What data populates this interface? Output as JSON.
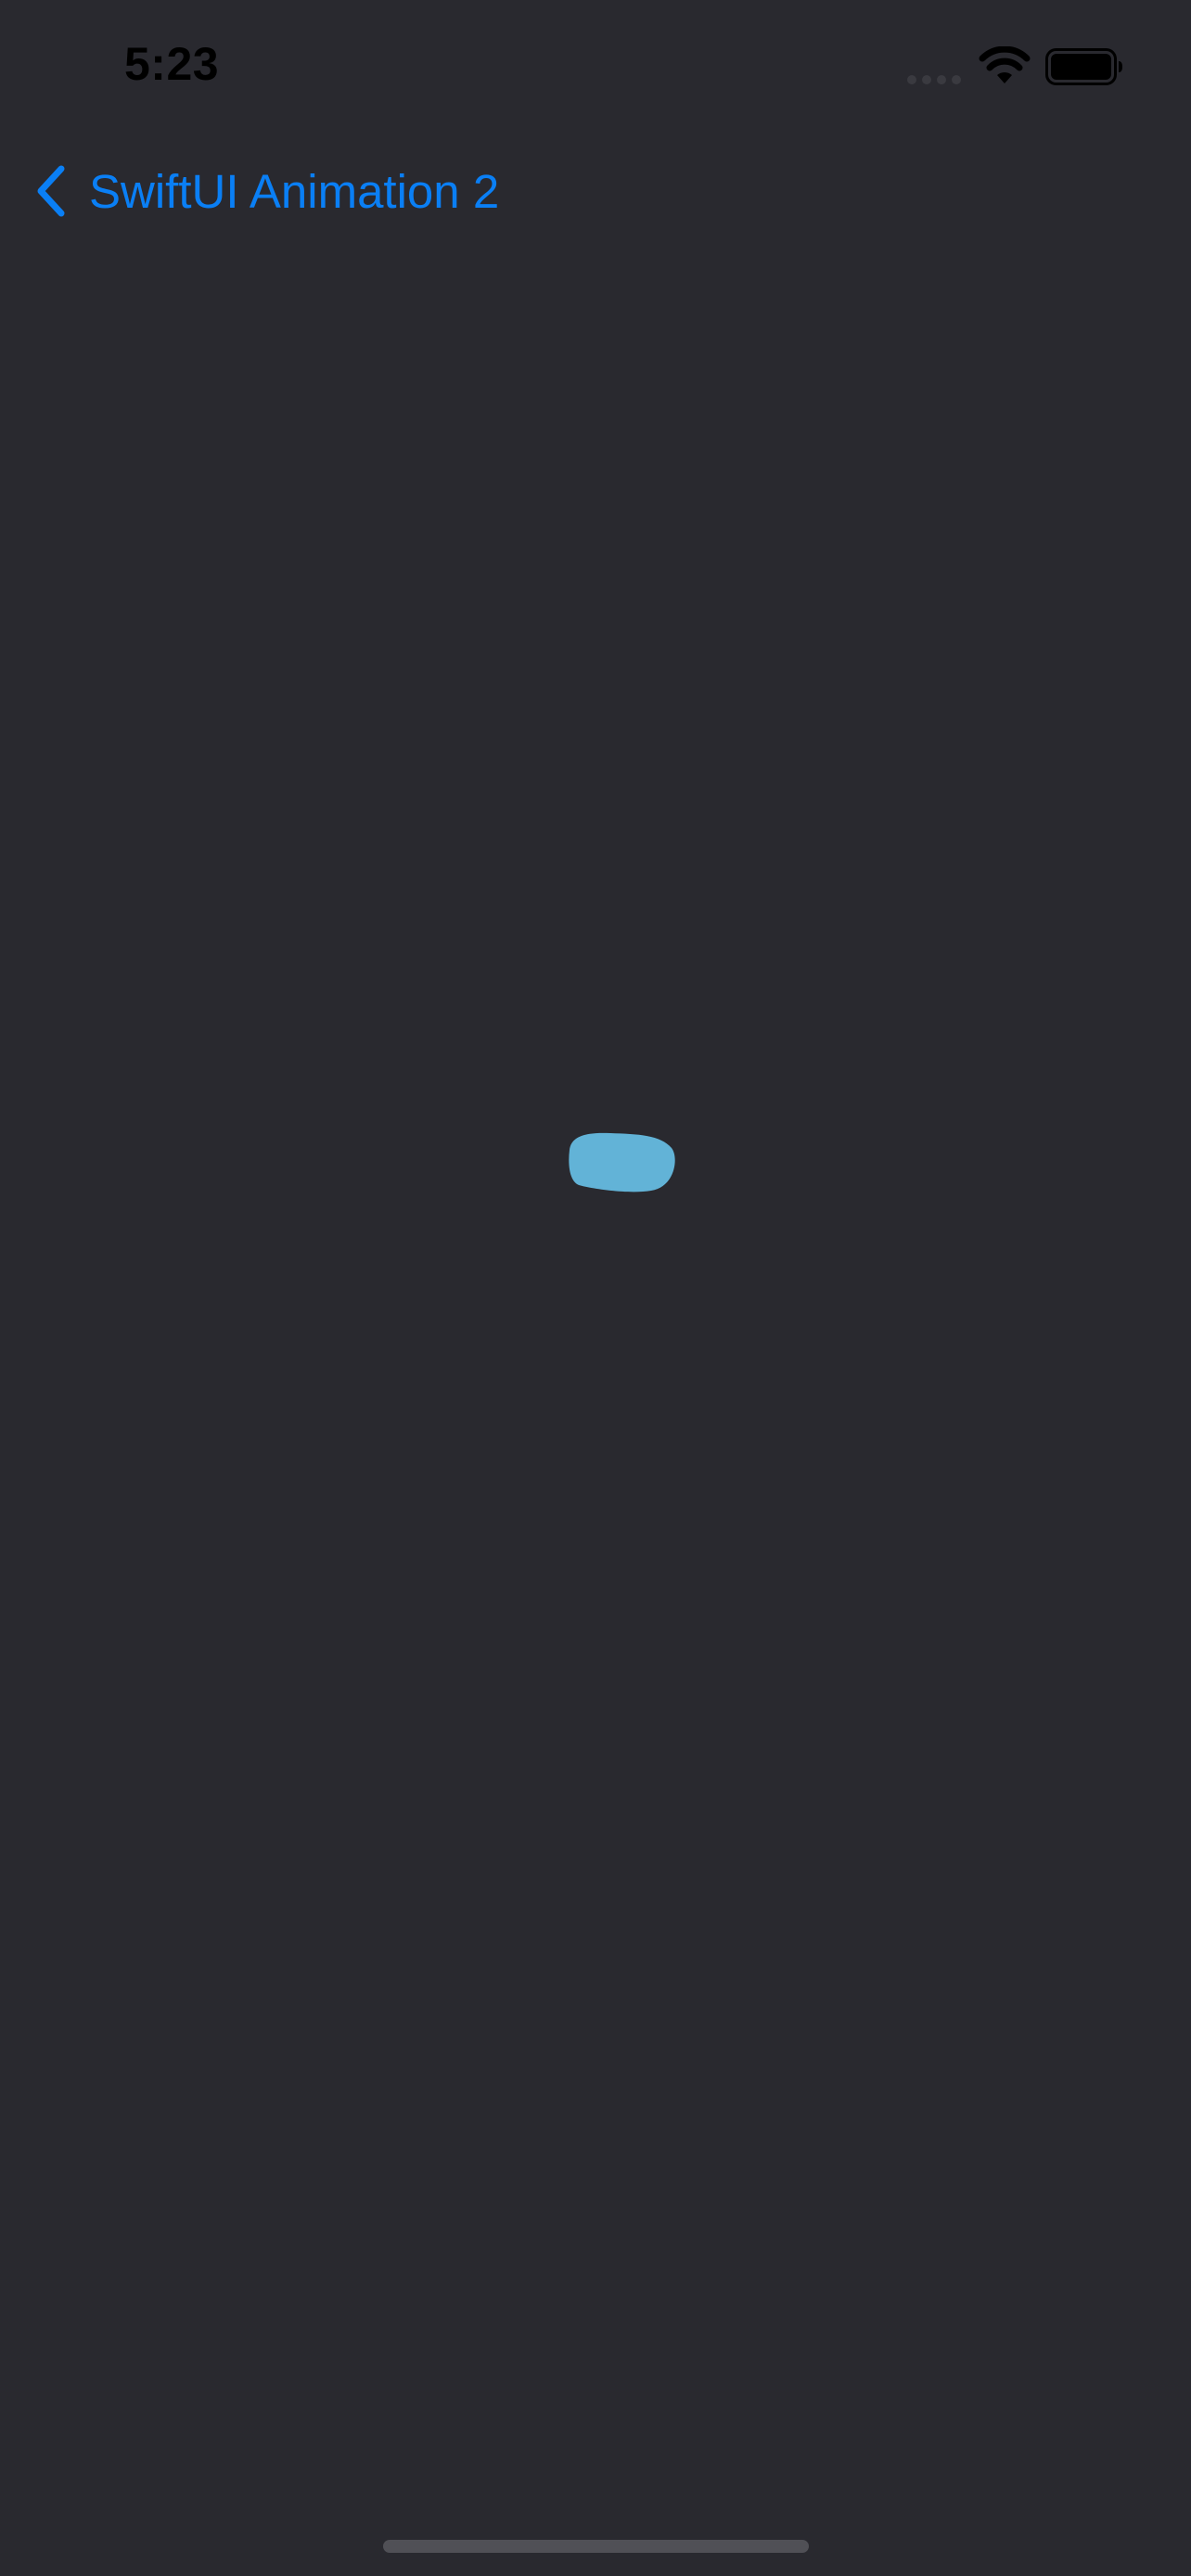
{
  "status_bar": {
    "time": "5:23",
    "icons": [
      "signal-dots-icon",
      "wifi-icon",
      "battery-icon"
    ]
  },
  "nav": {
    "back_label": "SwiftUI Animation 2",
    "back_icon": "chevron-left-icon"
  },
  "animation": {
    "shape": "blob"
  },
  "colors": {
    "background": "#29292f",
    "accent": "#0a7ff5",
    "blob_fill": "#62b3d7",
    "status_text": "#000000",
    "home_indicator": "#505056"
  }
}
